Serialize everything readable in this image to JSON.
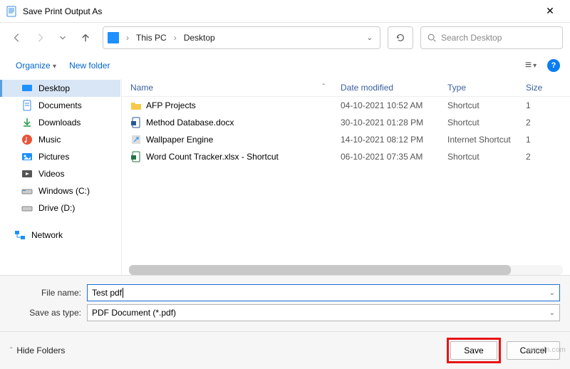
{
  "window": {
    "title": "Save Print Output As",
    "close": "✕"
  },
  "nav": {
    "breadcrumb": {
      "pc": "This PC",
      "location": "Desktop"
    },
    "search_placeholder": "Search Desktop"
  },
  "toolbar": {
    "organize": "Organize",
    "new_folder": "New folder",
    "view_menu_glyph": "≡"
  },
  "tree": {
    "items": [
      {
        "label": "Desktop"
      },
      {
        "label": "Documents"
      },
      {
        "label": "Downloads"
      },
      {
        "label": "Music"
      },
      {
        "label": "Pictures"
      },
      {
        "label": "Videos"
      },
      {
        "label": "Windows (C:)"
      },
      {
        "label": "Drive (D:)"
      }
    ],
    "network": "Network"
  },
  "files": {
    "headers": {
      "name": "Name",
      "date": "Date modified",
      "type": "Type",
      "size": "Size"
    },
    "rows": [
      {
        "name": "AFP Projects",
        "date": "04-10-2021 10:52 AM",
        "type": "Shortcut",
        "size": "1"
      },
      {
        "name": "Method Database.docx",
        "date": "30-10-2021 01:28 PM",
        "type": "Shortcut",
        "size": "2"
      },
      {
        "name": "Wallpaper Engine",
        "date": "14-10-2021 08:12 PM",
        "type": "Internet Shortcut",
        "size": "1"
      },
      {
        "name": "Word Count Tracker.xlsx - Shortcut",
        "date": "06-10-2021 07:35 AM",
        "type": "Shortcut",
        "size": "2"
      }
    ]
  },
  "form": {
    "filename_label": "File name:",
    "filename_value": "Test pdf",
    "savetype_label": "Save as type:",
    "savetype_value": "PDF Document (*.pdf)"
  },
  "footer": {
    "hide_folders": "Hide Folders",
    "save": "Save",
    "cancel": "Cancel"
  },
  "watermark": "wsxdn.com"
}
